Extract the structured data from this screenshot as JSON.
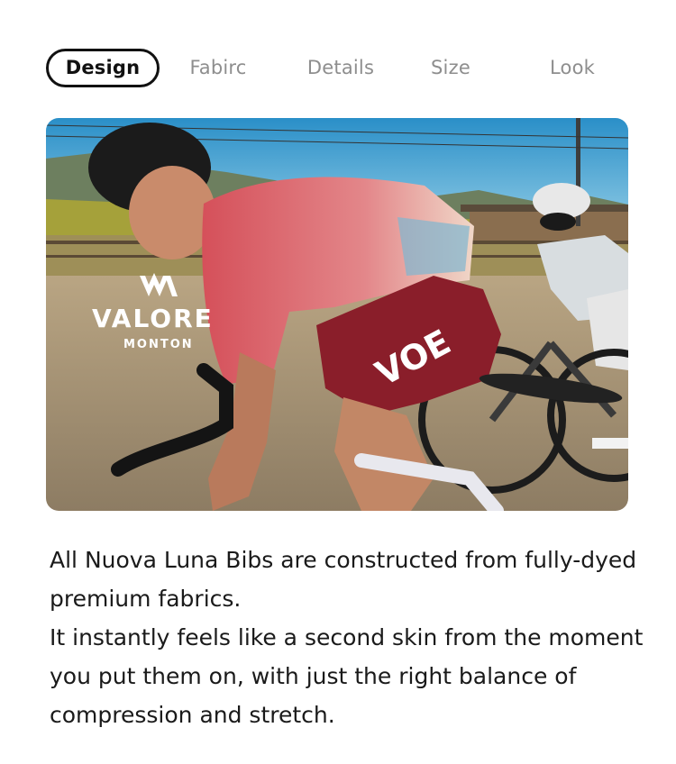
{
  "tabs": [
    {
      "label": "Design",
      "active": true
    },
    {
      "label": "Fabirc",
      "active": false
    },
    {
      "label": "Details",
      "active": false
    },
    {
      "label": "Size",
      "active": false
    },
    {
      "label": "Look",
      "active": false
    }
  ],
  "hero": {
    "brand_name": "VALORE",
    "brand_sub": "MONTON",
    "bib_text": "VOE"
  },
  "description": {
    "paragraph_1": "All Nuova Luna Bibs are constructed from fully-dyed premium fabrics.",
    "paragraph_2": "It instantly feels like a second skin from the moment you put them on, with just the right balance of compression and stretch."
  },
  "colors": {
    "active_tab_border": "#111111",
    "inactive_tab_text": "#8e8e8e",
    "jersey_red": "#c8404b",
    "bib_maroon": "#8a1e2a"
  }
}
